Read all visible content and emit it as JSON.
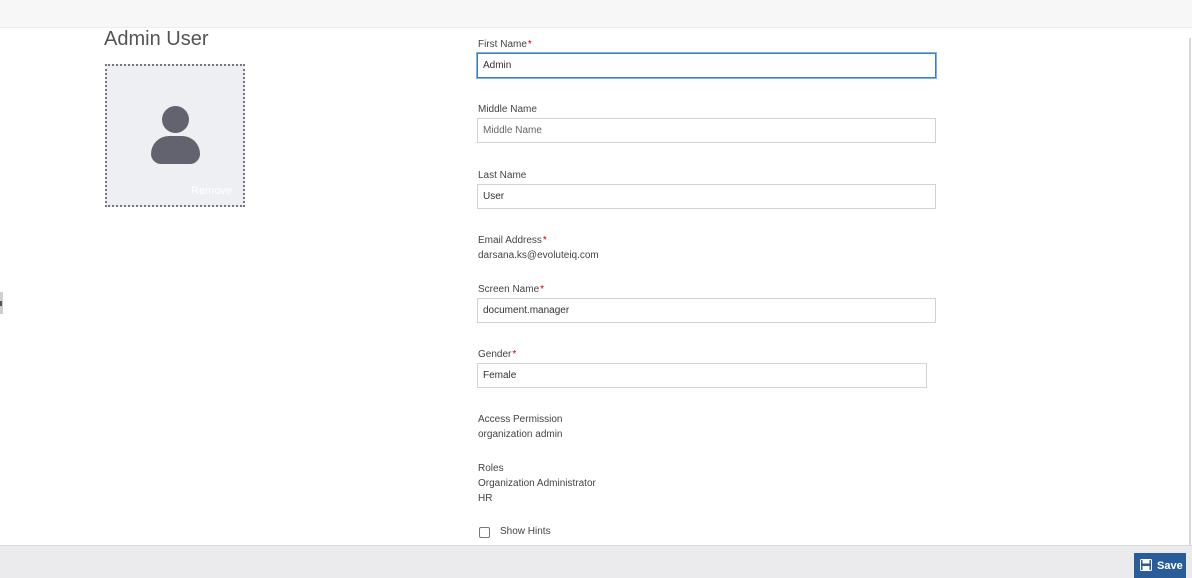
{
  "page": {
    "title": "Admin User"
  },
  "avatar": {
    "remove_label": "Remove"
  },
  "form": {
    "required_marker": "*",
    "first_name": {
      "label": "First Name",
      "value": "Admin"
    },
    "middle_name": {
      "label": "Middle Name",
      "value": "",
      "placeholder": "Middle Name"
    },
    "last_name": {
      "label": "Last Name",
      "value": "User"
    },
    "email": {
      "label": "Email Address",
      "value": "darsana.ks@evoluteiq.com"
    },
    "screen_name": {
      "label": "Screen Name",
      "value": "document.manager"
    },
    "gender": {
      "label": "Gender",
      "value": "Female"
    },
    "access_permission": {
      "label": "Access Permission",
      "value": "organization admin"
    },
    "roles": {
      "label": "Roles",
      "items": [
        "Organization Administrator",
        "HR"
      ]
    },
    "show_hints": {
      "label": "Show Hints",
      "checked": false
    }
  },
  "footer": {
    "save_label": "Save"
  },
  "colors": {
    "accent": "#2a5c9a",
    "focus_border": "#3a7fc1",
    "required": "#cc0000"
  },
  "icons": {
    "avatar": "user-silhouette-icon",
    "save": "floppy-disk-icon"
  }
}
